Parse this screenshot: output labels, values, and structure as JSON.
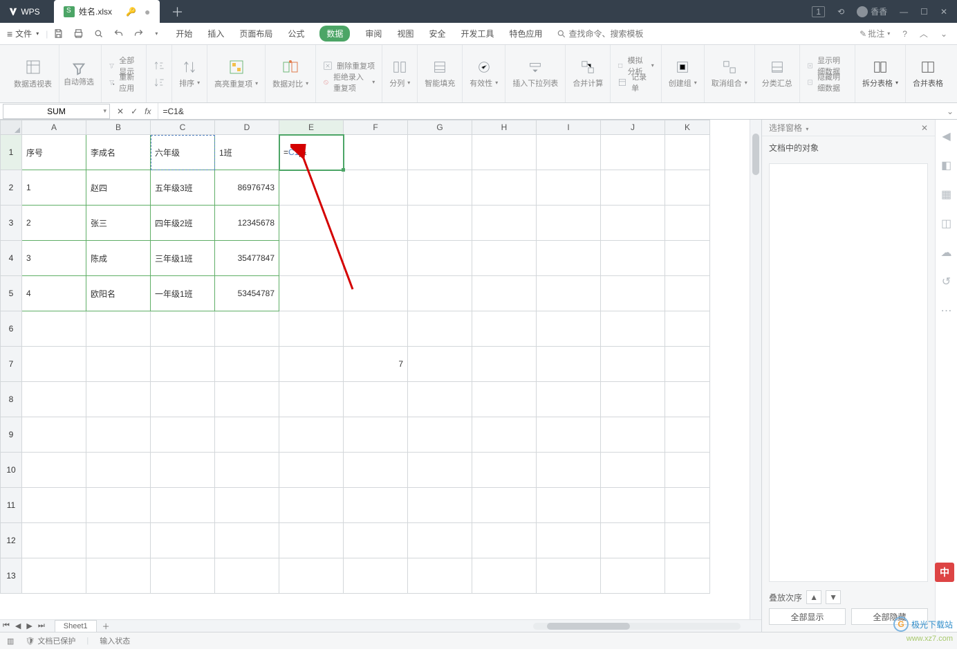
{
  "title": {
    "app": "WPS",
    "doc": "姓名.xlsx"
  },
  "titlebar_right": {
    "badge": "1",
    "user": "香香"
  },
  "menu": {
    "file": "文件",
    "items": [
      "开始",
      "插入",
      "页面布局",
      "公式",
      "数据",
      "审阅",
      "视图",
      "安全",
      "开发工具",
      "特色应用"
    ],
    "active_index": 4,
    "search_placeholder": "查找命令、搜索模板",
    "annotate": "批注"
  },
  "ribbon": {
    "pivot": "数据透视表",
    "autofilter": "自动筛选",
    "showall": "全部显示",
    "reapply": "重新应用",
    "sort_small": "排序",
    "highlight_dup": "高亮重复项",
    "data_compare": "数据对比",
    "delete_dup": "删除重复项",
    "reject_dup": "拒绝录入重复项",
    "text_to_cols": "分列",
    "flash_fill": "智能填充",
    "validation": "有效性",
    "insert_dropdown": "插入下拉列表",
    "consolidate": "合并计算",
    "sim_analysis": "模拟分析",
    "record_form": "记录单",
    "group_create": "创建组",
    "group_ungroup": "取消组合",
    "subtotal": "分类汇总",
    "show_detail": "显示明细数据",
    "hide_detail": "隐藏明细数据",
    "split_table": "拆分表格",
    "merge_table": "合并表格"
  },
  "formula": {
    "name_box": "SUM",
    "input": "=C1&"
  },
  "columns": [
    "A",
    "B",
    "C",
    "D",
    "E",
    "F",
    "G",
    "H",
    "I",
    "J",
    "K"
  ],
  "rows": [
    "1",
    "2",
    "3",
    "4",
    "5",
    "6",
    "7",
    "8",
    "9",
    "10",
    "11",
    "12",
    "13"
  ],
  "cells": {
    "A1": "序号",
    "B1": "李成名",
    "C1": "六年级",
    "D1": "1班",
    "E1_formula": {
      "eq": "=",
      "ref": "C1",
      "amp": "&"
    },
    "A2": "1",
    "B2": "赵四",
    "C2": "五年级3班",
    "D2": "86976743",
    "A3": "2",
    "B3": "张三",
    "C3": "四年级2班",
    "D3": "12345678",
    "A4": "3",
    "B4": "陈成",
    "C4": "三年级1班",
    "D4": "35477847",
    "A5": "4",
    "B5": "欧阳名",
    "C5": "一年级1班",
    "D5": "53454787",
    "F7": "7"
  },
  "sheet_tab": "Sheet1",
  "side_panel": {
    "header": "选择窗格",
    "sub": "文档中的对象",
    "order": "叠放次序",
    "show_all": "全部显示",
    "hide_all": "全部隐藏"
  },
  "statusbar": {
    "protect": "文档已保护",
    "input_state": "输入状态"
  },
  "watermark": {
    "site": "极光下载站",
    "url": "www.xz7.com"
  },
  "ime": "中"
}
